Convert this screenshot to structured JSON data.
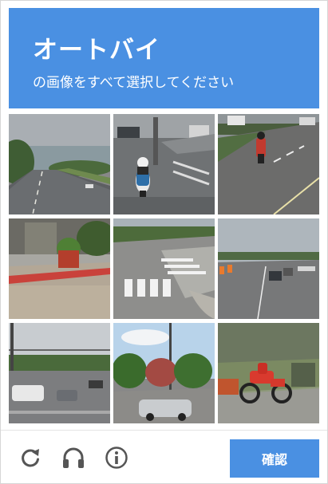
{
  "header": {
    "title": "オートバイ",
    "subtitle": "の画像をすべて選択してください"
  },
  "grid": {
    "tiles": [
      {
        "icon": "road-scene"
      },
      {
        "icon": "motorcycle-scene"
      },
      {
        "icon": "motorcycle-scene"
      },
      {
        "icon": "sidewalk-scene"
      },
      {
        "icon": "crosswalk-scene"
      },
      {
        "icon": "road-scene"
      },
      {
        "icon": "road-scene"
      },
      {
        "icon": "car-scene"
      },
      {
        "icon": "motorcycle-scene"
      }
    ]
  },
  "footer": {
    "reload_icon": "reload-icon",
    "audio_icon": "headphones-icon",
    "info_icon": "info-icon",
    "verify_label": "確認"
  },
  "colors": {
    "accent": "#4a90e2",
    "icon": "#555555"
  }
}
